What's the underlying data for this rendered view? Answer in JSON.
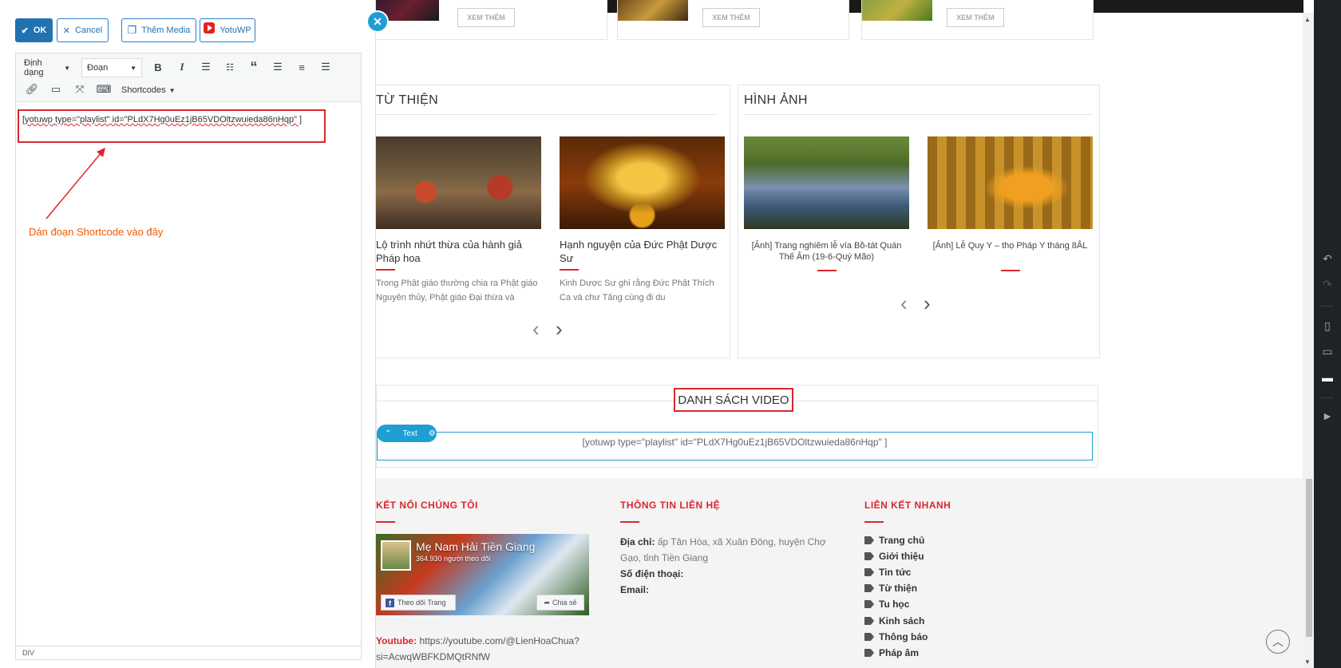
{
  "editor": {
    "ok_label": "OK",
    "cancel_label": "Cancel",
    "add_media_label": "Thêm Media",
    "yotuwp_label": "YotuWP",
    "format_select": "Định dạng",
    "paragraph_select": "Đoạn",
    "shortcodes_label": "Shortcodes",
    "content": "[yotuwp type=\"playlist\" id=\"PLdX7Hg0uEz1jB65VDOltzwuieda86nHqp\" ]",
    "annotation": "Dán đoạn Shortcode vào đây",
    "status_path": "DIV"
  },
  "preview": {
    "read_more": "XEM THÊM",
    "charity": {
      "title": "TỪ THIỆN",
      "posts": [
        {
          "title": "Lộ trình nhứt thừa của hành giả Pháp hoa",
          "excerpt": "Trong Phật giáo thường chia ra Phật giáo Nguyên thủy, Phật giáo Đại thừa và"
        },
        {
          "title": "Hạnh nguyện của Đức Phật Dược Sư",
          "excerpt": "Kinh Dược Sư ghi rằng Đức Phật Thích Ca và chư Tăng cùng đi du"
        }
      ]
    },
    "images": {
      "title": "HÌNH ẢNH",
      "posts": [
        {
          "title": "[Ảnh] Trang nghiêm lễ vía Bồ-tát Quán Thế Âm (19-6-Quý Mão)"
        },
        {
          "title": "[Ảnh] Lễ Quy Y – thọ Pháp Y tháng 8ÂL"
        }
      ]
    },
    "video": {
      "title": "DANH SÁCH VIDEO",
      "widget_label": "Text",
      "shortcode": "[yotuwp type=\"playlist\" id=\"PLdX7Hg0uEz1jB65VDOltzwuieda86nHqp\" ]"
    },
    "footer": {
      "connect": {
        "heading": "KẾT NỐI CHÚNG TÔI",
        "fb_name": "Mẹ Nam Hải Tiền Giang",
        "fb_followers": "364.930 người theo dõi",
        "fb_follow": "Theo dõi Trang",
        "fb_share": "Chia sẻ",
        "youtube_label": "Youtube:",
        "youtube_url": "https://youtube.com/@LienHoaChua?si=AcwqWBFKDMQtRNfW"
      },
      "contact": {
        "heading": "THÔNG TIN LIÊN HỆ",
        "address_label": "Địa chỉ:",
        "address": "ấp Tân Hòa, xã Xuân Đông, huyện Chợ Gạo, tỉnh Tiền Giang",
        "phone_label": "Số điện thoại:",
        "email_label": "Email:"
      },
      "quick_links": {
        "heading": "LIÊN KẾT NHANH",
        "items": [
          "Trang chủ",
          "Giới thiệu",
          "Tin tức",
          "Từ thiện",
          "Tu học",
          "Kinh sách",
          "Thông báo",
          "Pháp âm"
        ]
      }
    }
  },
  "colors": {
    "accent_red": "#d9272e",
    "wp_blue": "#2271b1",
    "widget_blue": "#1e9fd4",
    "annotation_orange": "#f05a00"
  }
}
